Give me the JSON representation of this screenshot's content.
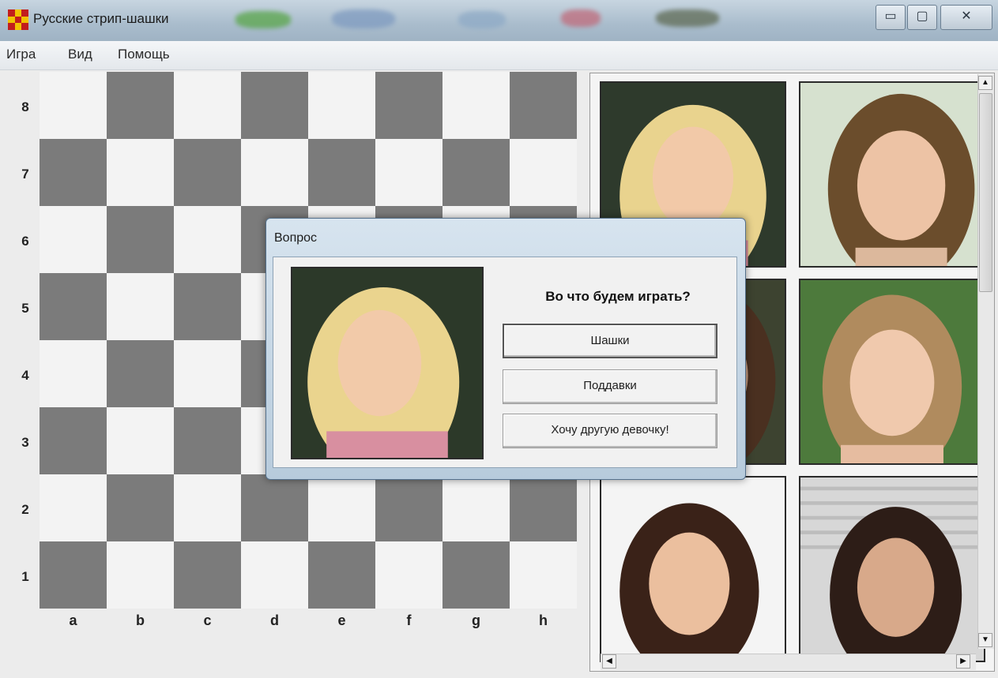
{
  "window": {
    "title": "Русские стрип-шашки"
  },
  "menu": {
    "items": [
      "Игра",
      "Вид",
      "Помощь"
    ]
  },
  "board": {
    "ranks": [
      "8",
      "7",
      "6",
      "5",
      "4",
      "3",
      "2",
      "1"
    ],
    "files": [
      "a",
      "b",
      "c",
      "d",
      "e",
      "f",
      "g",
      "h"
    ]
  },
  "dialog": {
    "title": "Вопрос",
    "question": "Во что будем играть?",
    "buttons": [
      "Шашки",
      "Поддавки",
      "Хочу другую девочку!"
    ]
  },
  "colors": {
    "dark_square": "#7b7b7b",
    "light_square": "#f3f3f3"
  },
  "gallery": {
    "photos": [
      "portrait-blonde",
      "portrait-brunette-green",
      "portrait-dark-hair",
      "portrait-light-brown",
      "portrait-dark-hair-smile",
      "portrait-dark-hair-blinds"
    ]
  }
}
